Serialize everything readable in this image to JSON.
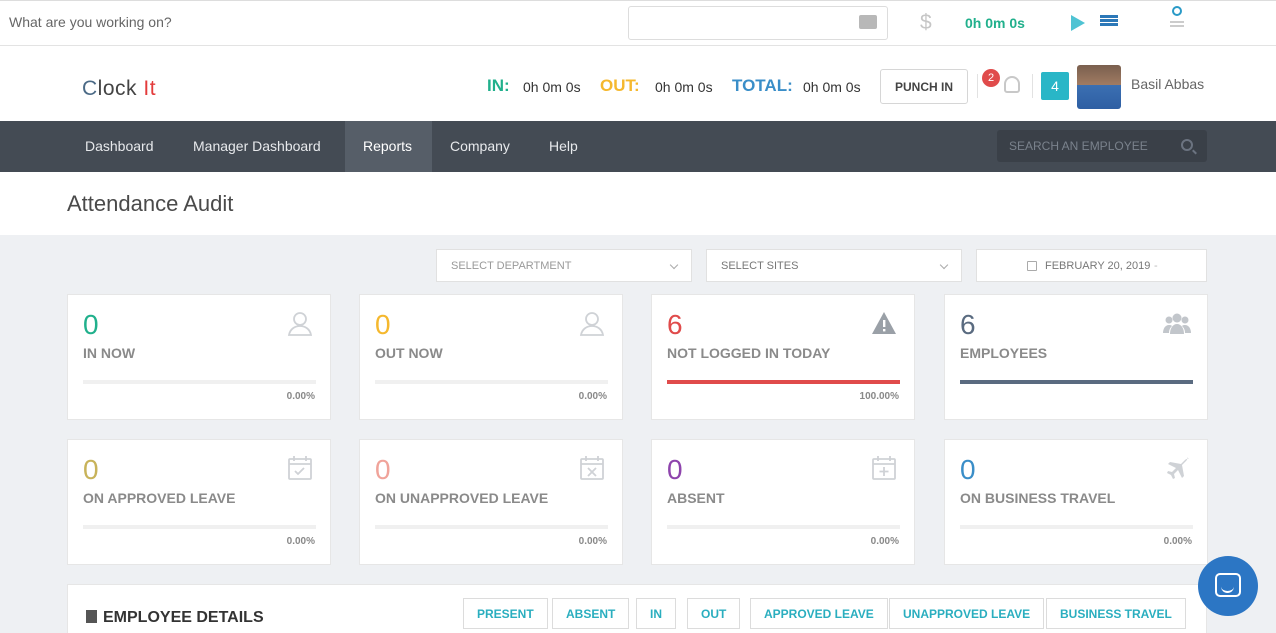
{
  "tracker": {
    "task_placeholder": "What are you working on?",
    "billable_icon": "$",
    "timer": "0h 0m 0s"
  },
  "header": {
    "logo_c": "C",
    "logo_lock": "lock ",
    "logo_it": "It",
    "in_label": "IN:",
    "in_value": "0h 0m 0s",
    "out_label": "OUT:",
    "out_value": "0h 0m 0s",
    "total_label": "TOTAL:",
    "total_value": "0h 0m 0s",
    "punch_label": "PUNCH IN",
    "notification_count": "2",
    "team_count": "4",
    "user_name": "Basil Abbas"
  },
  "nav": {
    "items": [
      "Dashboard",
      "Manager Dashboard",
      "Reports",
      "Company",
      "Help"
    ],
    "active": "Reports",
    "search_placeholder": "SEARCH AN EMPLOYEE"
  },
  "page": {
    "title": "Attendance Audit"
  },
  "filters": {
    "department": "SELECT DEPARTMENT",
    "sites": "SELECT SITES",
    "date": "FEBRUARY 20, 2019",
    "date_sep": "-"
  },
  "cards": [
    {
      "value": "0",
      "label": "IN NOW",
      "pct": "0.00%",
      "fill": 0,
      "color": "#21b08c",
      "bar_color": "#21b08c",
      "icon": "user-outline-icon"
    },
    {
      "value": "0",
      "label": "OUT NOW",
      "pct": "0.00%",
      "fill": 0,
      "color": "#f5b82e",
      "bar_color": "#f5b82e",
      "icon": "user-outline-icon"
    },
    {
      "value": "6",
      "label": "NOT LOGGED IN TODAY",
      "pct": "100.00%",
      "fill": 1,
      "color": "#e04b4b",
      "bar_color": "#e04b4b",
      "icon": "warning-icon"
    },
    {
      "value": "6",
      "label": "EMPLOYEES",
      "pct": "",
      "fill": 1,
      "color": "#5a6b80",
      "bar_color": "#5a6b80",
      "icon": "users-icon"
    },
    {
      "value": "0",
      "label": "ON APPROVED LEAVE",
      "pct": "0.00%",
      "fill": 0,
      "color": "#c8b35a",
      "bar_color": "#c8b35a",
      "icon": "calendar-check-icon"
    },
    {
      "value": "0",
      "label": "ON UNAPPROVED LEAVE",
      "pct": "0.00%",
      "fill": 0,
      "color": "#f0a39a",
      "bar_color": "#f0a39a",
      "icon": "calendar-x-icon"
    },
    {
      "value": "0",
      "label": "ABSENT",
      "pct": "0.00%",
      "fill": 0,
      "color": "#8e44ad",
      "bar_color": "#8e44ad",
      "icon": "calendar-plus-icon"
    },
    {
      "value": "0",
      "label": "ON BUSINESS TRAVEL",
      "pct": "0.00%",
      "fill": 0,
      "color": "#3a8ec8",
      "bar_color": "#3a8ec8",
      "icon": "plane-icon"
    }
  ],
  "details": {
    "title": "EMPLOYEE DETAILS",
    "filters": [
      "PRESENT",
      "ABSENT",
      "IN",
      "OUT",
      "APPROVED LEAVE",
      "UNAPPROVED LEAVE",
      "BUSINESS TRAVEL"
    ]
  }
}
